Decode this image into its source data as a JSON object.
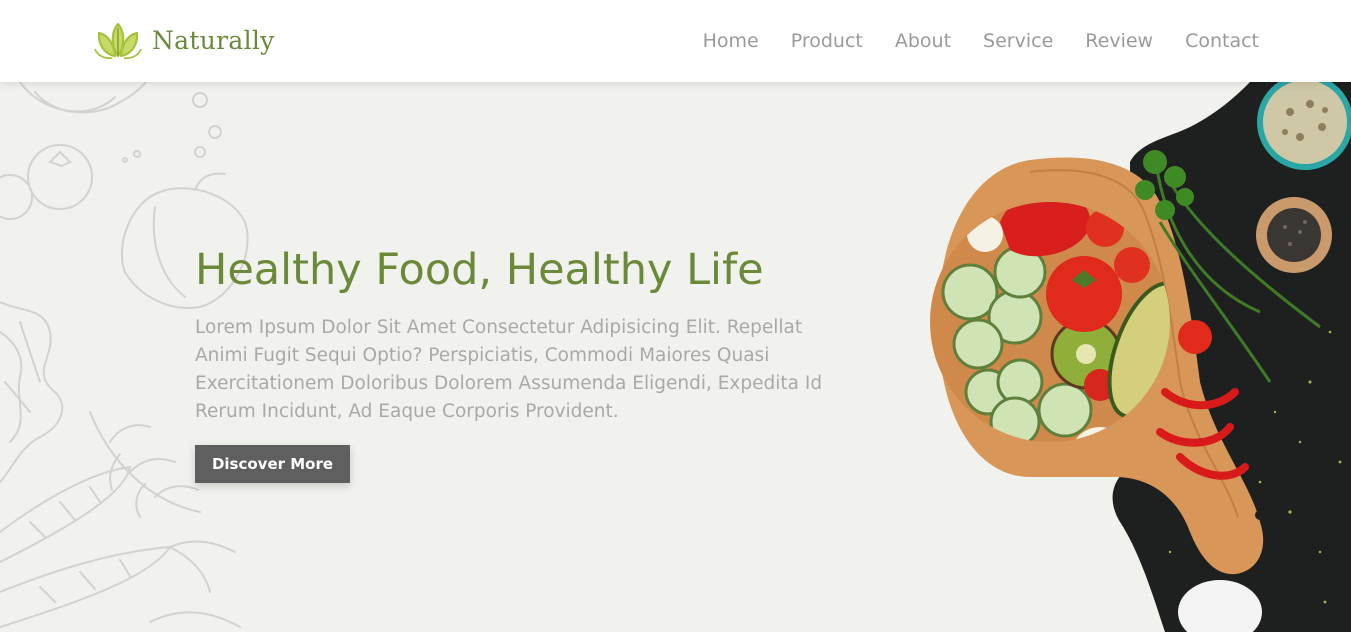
{
  "header": {
    "logo_icon": "leaf-lotus-icon",
    "logo_text": "Naturally",
    "nav": [
      {
        "label": "Home"
      },
      {
        "label": "Product"
      },
      {
        "label": "About"
      },
      {
        "label": "Service"
      },
      {
        "label": "Review"
      },
      {
        "label": "Contact"
      }
    ]
  },
  "hero": {
    "title": "Healthy Food, Healthy Life",
    "description": "Lorem Ipsum Dolor Sit Amet Consectetur Adipisicing Elit. Repellat Animi Fugit Sequi Optio? Perspiciatis, Commodi Maiores Quasi Exercitationem Doloribus Dolorem Assumenda Eligendi, Expedita Id Rerum Incidunt, Ad Eaque Corporis Provident.",
    "cta_label": "Discover More",
    "decor_left": "vegetable-sketch-illustration",
    "decor_right": "vegetables-cutting-board-photo"
  },
  "colors": {
    "accent": "#6a8a3a",
    "logo_green": "#9bbf3b",
    "nav_text": "#9a9a9a",
    "body_text": "#a9a9a9",
    "button_bg": "#5f5f5f",
    "hero_bg": "#f1f1ee"
  }
}
